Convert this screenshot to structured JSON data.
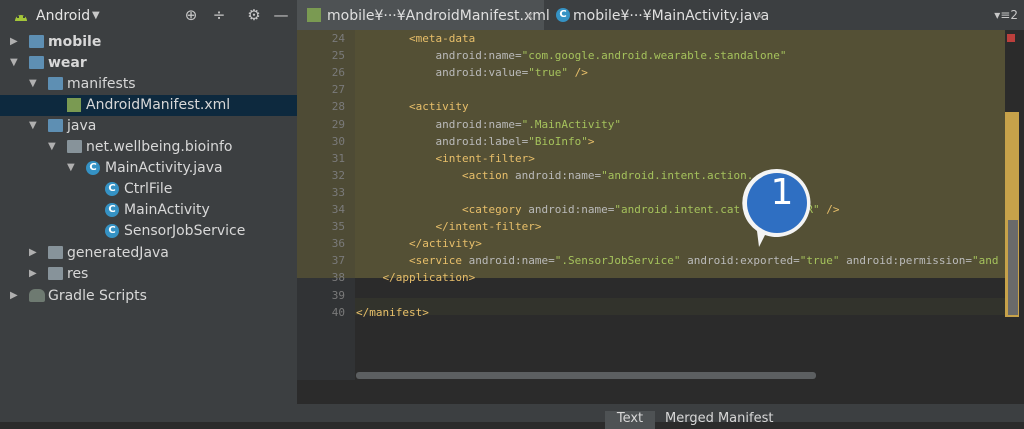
{
  "project_panel": {
    "view_label": "Android",
    "tree": [
      {
        "label": "mobile",
        "bold": true
      },
      {
        "label": "wear",
        "bold": true
      },
      {
        "label": "manifests"
      },
      {
        "label": "AndroidManifest.xml"
      },
      {
        "label": "java"
      },
      {
        "label": "net.wellbeing.bioinfo"
      },
      {
        "label": "MainActivity.java"
      },
      {
        "label": "CtrlFile"
      },
      {
        "label": "MainActivity"
      },
      {
        "label": "SensorJobService"
      },
      {
        "label": "generatedJava"
      },
      {
        "label": "res"
      },
      {
        "label": "Gradle Scripts"
      }
    ]
  },
  "tabs": [
    {
      "label": "mobile¥···¥AndroidManifest.xml"
    },
    {
      "label": "mobile¥···¥MainActivity.java"
    }
  ],
  "tab_overflow": "▾≡2",
  "editor": {
    "lines": [
      {
        "num": "24",
        "indent": 2,
        "parts": [
          {
            "t": "<meta-data",
            "c": "tag"
          }
        ]
      },
      {
        "num": "25",
        "indent": 3,
        "parts": [
          {
            "t": "android",
            "c": "attr"
          },
          {
            "t": ":name=",
            "c": "attr"
          },
          {
            "t": "\"com.google.android.wearable.standalone\"",
            "c": "val"
          }
        ]
      },
      {
        "num": "26",
        "indent": 3,
        "parts": [
          {
            "t": "android",
            "c": "attr"
          },
          {
            "t": ":value=",
            "c": "attr"
          },
          {
            "t": "\"true\"",
            "c": "val"
          },
          {
            "t": " />",
            "c": "tag"
          }
        ]
      },
      {
        "num": "27",
        "indent": 0,
        "parts": []
      },
      {
        "num": "28",
        "indent": 2,
        "parts": [
          {
            "t": "<activity",
            "c": "tag"
          }
        ]
      },
      {
        "num": "29",
        "indent": 3,
        "parts": [
          {
            "t": "android",
            "c": "attr"
          },
          {
            "t": ":name=",
            "c": "attr"
          },
          {
            "t": "\".MainActivity\"",
            "c": "val"
          }
        ]
      },
      {
        "num": "30",
        "indent": 3,
        "parts": [
          {
            "t": "android",
            "c": "attr"
          },
          {
            "t": ":label=",
            "c": "attr"
          },
          {
            "t": "\"BioInfo\"",
            "c": "val"
          },
          {
            "t": ">",
            "c": "tag"
          }
        ]
      },
      {
        "num": "31",
        "indent": 3,
        "parts": [
          {
            "t": "<intent-filter>",
            "c": "tag"
          }
        ]
      },
      {
        "num": "32",
        "indent": 4,
        "parts": [
          {
            "t": "<action ",
            "c": "tag"
          },
          {
            "t": "android",
            "c": "attr"
          },
          {
            "t": ":name=",
            "c": "attr"
          },
          {
            "t": "\"android.intent.action.",
            "c": "val"
          }
        ]
      },
      {
        "num": "33",
        "indent": 0,
        "parts": []
      },
      {
        "num": "34",
        "indent": 4,
        "parts": [
          {
            "t": "<category ",
            "c": "tag"
          },
          {
            "t": "android",
            "c": "attr"
          },
          {
            "t": ":name=",
            "c": "attr"
          },
          {
            "t": "\"android.intent.cat",
            "c": "val"
          },
          {
            "t": "         ER\"",
            "c": "val"
          },
          {
            "t": " />",
            "c": "tag"
          }
        ]
      },
      {
        "num": "35",
        "indent": 3,
        "parts": [
          {
            "t": "</intent-filter>",
            "c": "tag"
          }
        ]
      },
      {
        "num": "36",
        "indent": 2,
        "parts": [
          {
            "t": "</activity>",
            "c": "tag"
          }
        ]
      },
      {
        "num": "37",
        "indent": 2,
        "parts": [
          {
            "t": "<service ",
            "c": "tag"
          },
          {
            "t": "android",
            "c": "attr"
          },
          {
            "t": ":name=",
            "c": "attr"
          },
          {
            "t": "\".SensorJobService\"",
            "c": "val"
          },
          {
            "t": " android",
            "c": "attr"
          },
          {
            "t": ":exported=",
            "c": "attr"
          },
          {
            "t": "\"true\"",
            "c": "val"
          },
          {
            "t": " android",
            "c": "attr"
          },
          {
            "t": ":permission=",
            "c": "attr"
          },
          {
            "t": "\"and",
            "c": "val"
          }
        ]
      },
      {
        "num": "38",
        "indent": 1,
        "parts": [
          {
            "t": "</application>",
            "c": "tag"
          }
        ]
      },
      {
        "num": "39",
        "indent": 0,
        "parts": []
      },
      {
        "num": "40",
        "indent": 0,
        "parts": [
          {
            "t": "</manifest>",
            "c": "tag"
          }
        ]
      }
    ]
  },
  "bottom_tabs": {
    "text": "Text",
    "merged": "Merged Manifest"
  },
  "badge": {
    "label": "1",
    "color": "#2f6fc2"
  },
  "colors": {
    "tag": "#e8bf6a",
    "value": "#a5c25c",
    "highlight": "#545035",
    "selection": "#0d293e"
  }
}
